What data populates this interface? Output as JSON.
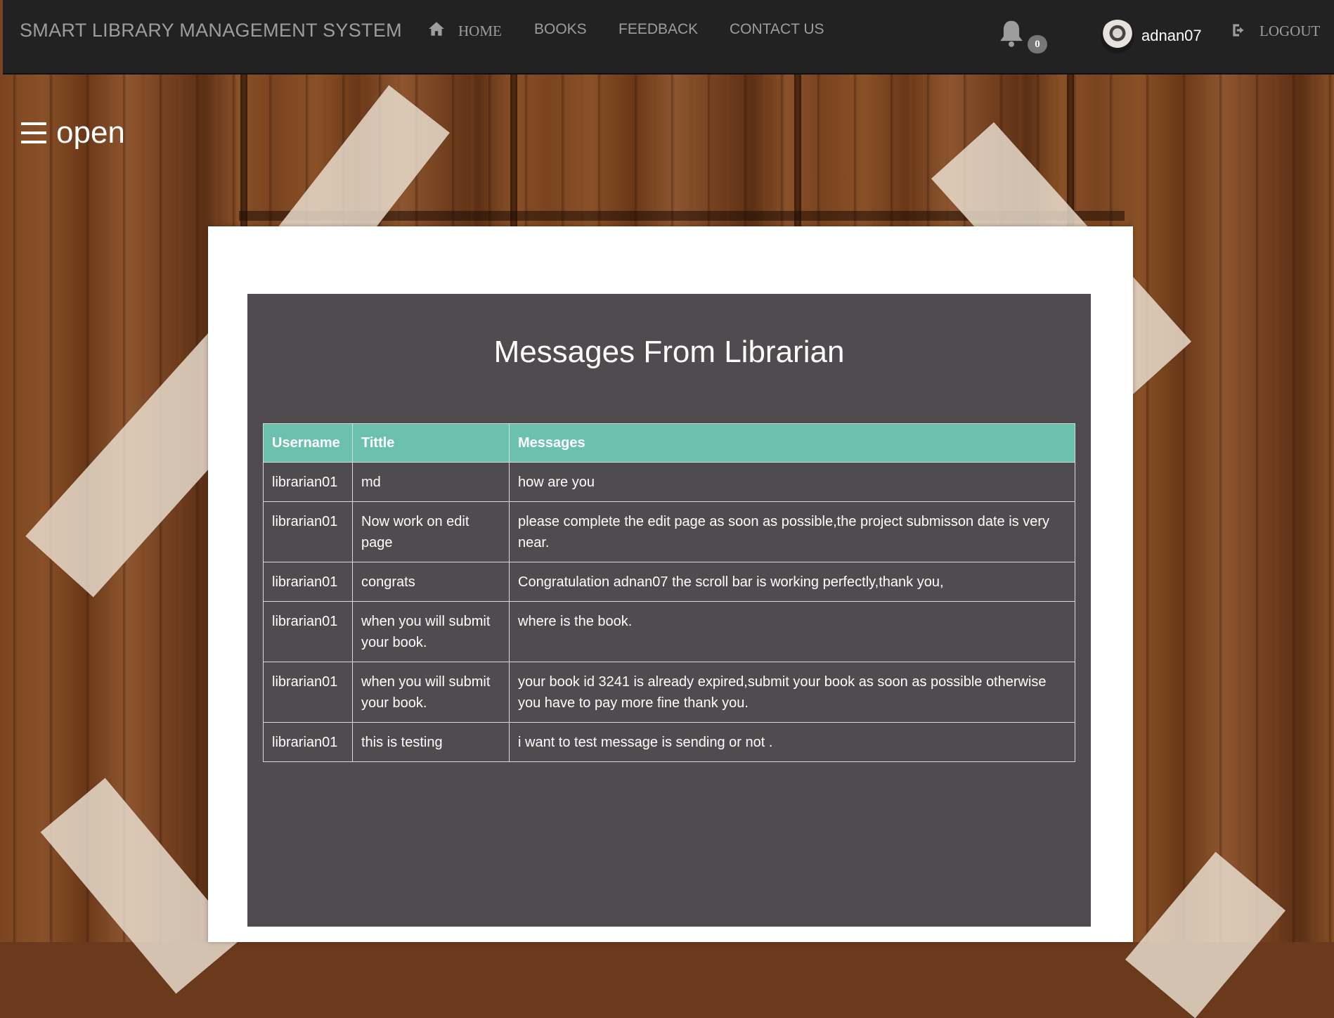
{
  "navbar": {
    "brand": "SMART LIBRARY MANAGEMENT SYSTEM",
    "home": "HOME",
    "books": "BOOKS",
    "feedback": "FEEDBACK",
    "contact": "CONTACT US",
    "notification_count": "0",
    "username": "adnan07",
    "logout": "LOGOUT"
  },
  "sidebar_toggle": {
    "label": "open"
  },
  "messages": {
    "title": "Messages From Librarian",
    "columns": [
      "Username",
      "Tittle",
      "Messages"
    ],
    "rows": [
      [
        "librarian01",
        "md",
        "how are you"
      ],
      [
        "librarian01",
        "Now work on edit page",
        "please complete the edit page as soon as possible,the project submisson date is very near."
      ],
      [
        "librarian01",
        "congrats",
        "Congratulation adnan07 the scroll bar is working perfectly,thank you,"
      ],
      [
        "librarian01",
        "when you will submit your book.",
        "where is the book."
      ],
      [
        "librarian01",
        "when you will submit your book.",
        "your book id 3241 is already expired,submit your book as soon as possible otherwise you have to pay more fine thank you."
      ],
      [
        "librarian01",
        "this is testing",
        "i want to test message is sending or not ."
      ]
    ]
  },
  "colors": {
    "navbar_bg": "#222222",
    "header_accent": "#6bc1ad",
    "panel_bg": "#4f4b4e"
  }
}
